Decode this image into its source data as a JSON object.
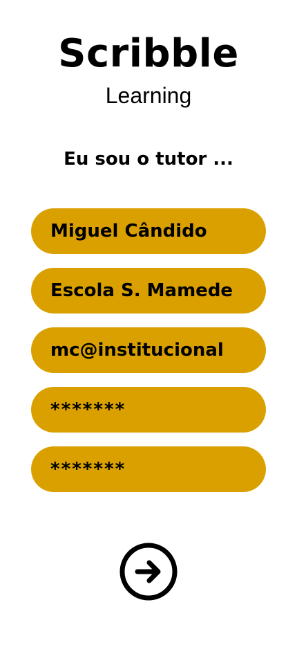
{
  "header": {
    "title": "Scribble",
    "subtitle": "Learning"
  },
  "prompt": "Eu sou o tutor ...",
  "form": {
    "fields": [
      {
        "value": "Miguel Cândido"
      },
      {
        "value": "Escola S. Mamede"
      },
      {
        "value": "mc@institucional"
      },
      {
        "value": "*******"
      },
      {
        "value": "*******"
      }
    ]
  },
  "actions": {
    "next_icon": "arrow-right-circle-icon"
  },
  "colors": {
    "field_background": "#d9a000",
    "text": "#000000",
    "background": "#ffffff"
  }
}
